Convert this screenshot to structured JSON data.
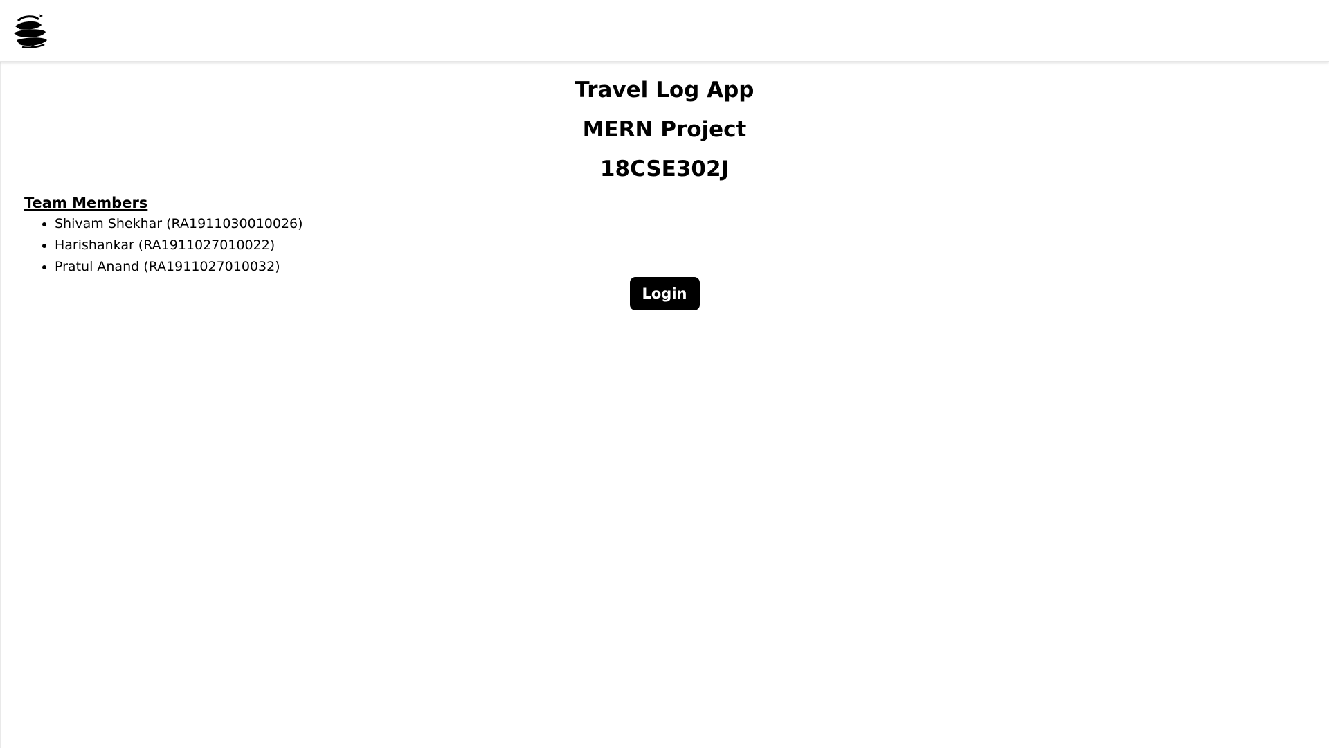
{
  "navbar": {
    "logo_icon": "globe-plane-logo-icon"
  },
  "headings": {
    "title": "Travel Log App",
    "subtitle": "MERN Project",
    "course_code": "18CSE302J"
  },
  "team": {
    "title": "Team Members",
    "members": [
      "Shivam Shekhar (RA1911030010026)",
      "Harishankar (RA1911027010022)",
      "Pratul Anand (RA1911027010032)"
    ]
  },
  "actions": {
    "login_label": "Login"
  },
  "colors": {
    "background": "#ffffff",
    "text": "#000000",
    "button_bg": "#000000",
    "button_text": "#ffffff"
  }
}
